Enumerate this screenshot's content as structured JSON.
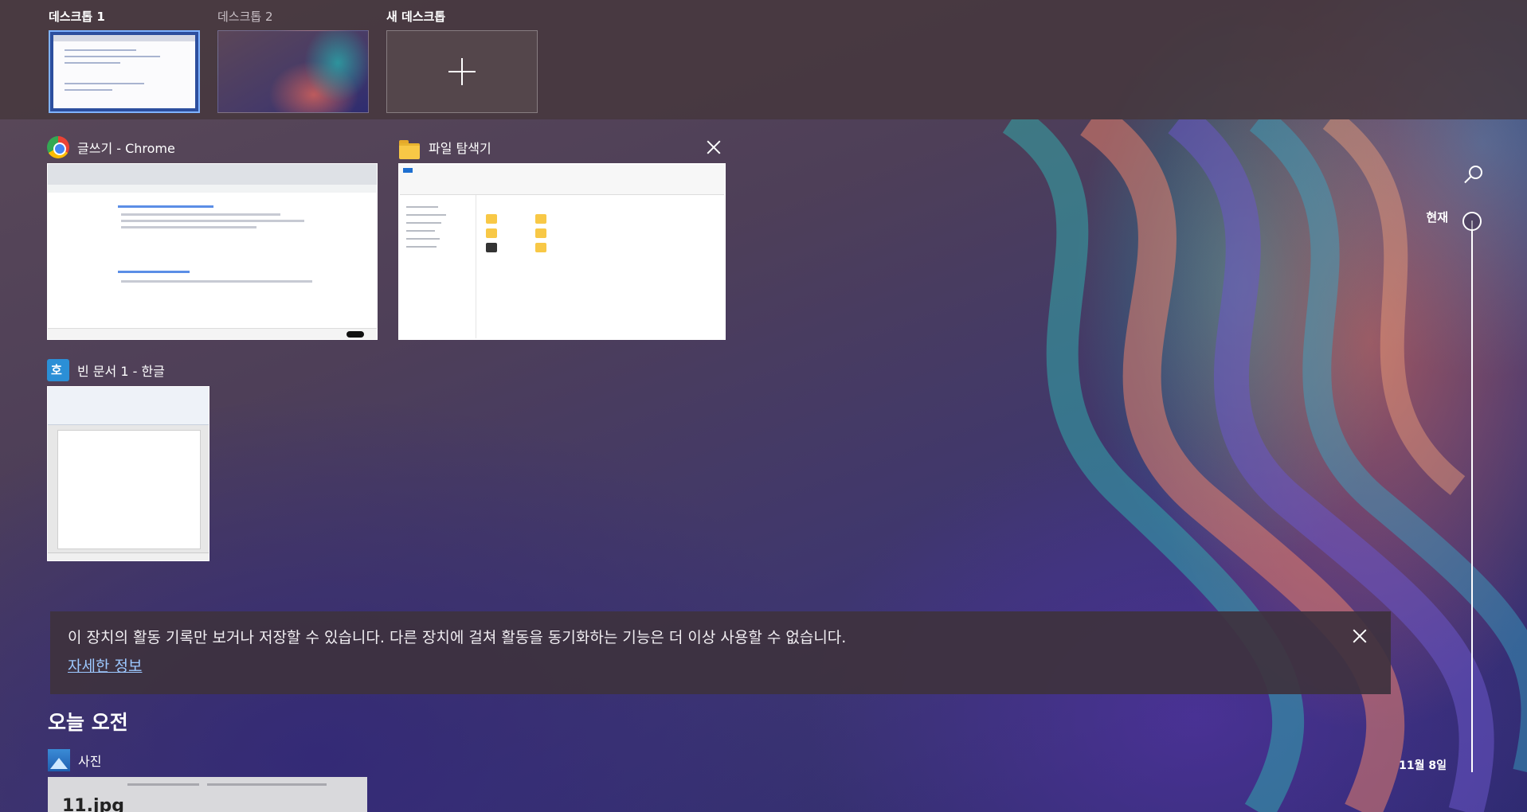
{
  "desktops": [
    {
      "label": "데스크톱 1",
      "active": true
    },
    {
      "label": "데스크톱 2",
      "active": false
    },
    {
      "label": "새 데스크톱",
      "active": false
    }
  ],
  "windows": {
    "chrome": {
      "title": "글쓰기 - Chrome",
      "icon": "chrome-icon"
    },
    "explorer": {
      "title": "파일 탐색기",
      "icon": "folder-icon"
    },
    "hwp": {
      "title": "빈 문서 1 - 한글",
      "icon": "hwp-icon"
    }
  },
  "timeline": {
    "now_label": "현재",
    "date_label": "11월 8일"
  },
  "notice": {
    "message": "이 장치의 활동 기록만 보거나 저장할 수 있습니다. 다른 장치에 걸쳐 활동을 동기화하는 기능은 더 이상 사용할 수 없습니다.",
    "link": "자세한 정보"
  },
  "today": {
    "section_title": "오늘 오전",
    "photo_app": "사진",
    "photo_caption": "11.jpg"
  },
  "colors": {
    "active_desktop_border": "#7fb3ff",
    "link": "#9dc8ff"
  }
}
